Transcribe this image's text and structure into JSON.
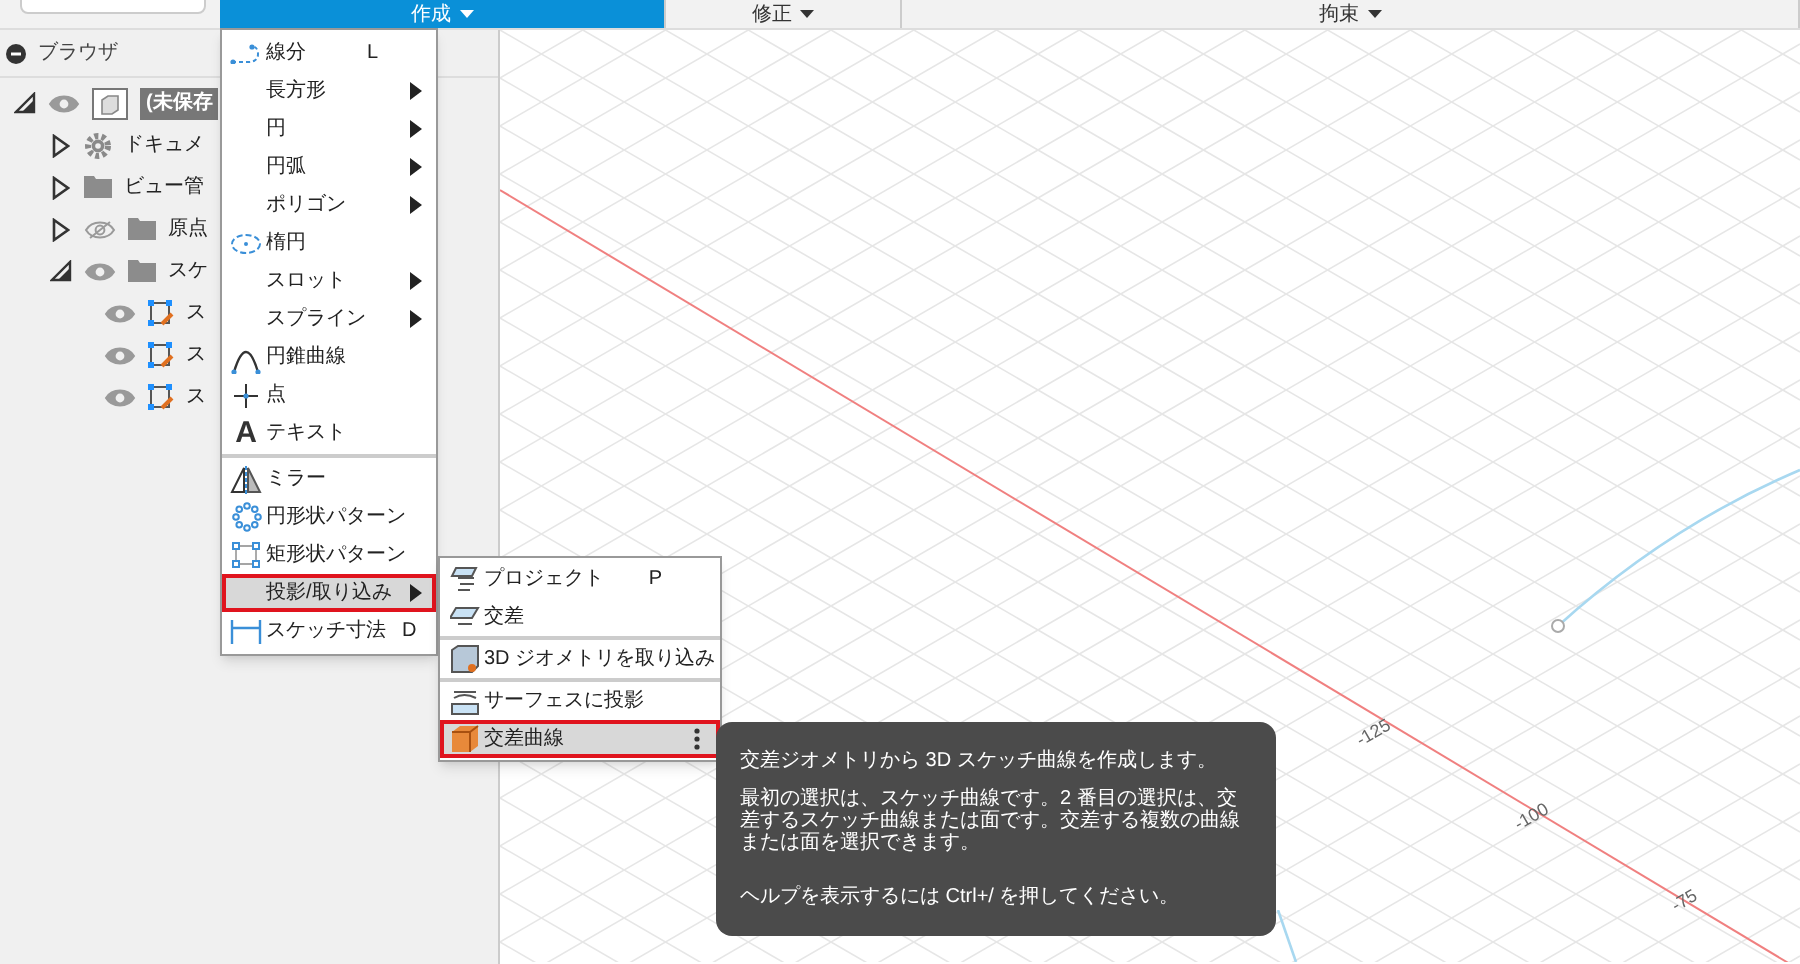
{
  "toolbar": {
    "tabs": [
      {
        "label": "作成",
        "selected": true
      },
      {
        "label": "修正",
        "selected": false
      },
      {
        "label": "拘束",
        "selected": false
      }
    ]
  },
  "browser": {
    "title": "ブラウザ",
    "tree": [
      {
        "label": "(未保存",
        "kind": "component",
        "expanded": true,
        "visible": true,
        "children": [
          {
            "label": "ドキュメ",
            "kind": "settings",
            "expanded": false
          },
          {
            "label": "ビュー管",
            "kind": "folder",
            "expanded": false
          },
          {
            "label": "原点",
            "kind": "folder",
            "expanded": false,
            "visible": false
          },
          {
            "label": "スケ",
            "kind": "folder",
            "expanded": true,
            "visible": true,
            "children": [
              {
                "label": "ス",
                "kind": "sketch",
                "visible": true
              },
              {
                "label": "ス",
                "kind": "sketch",
                "visible": true
              },
              {
                "label": "ス",
                "kind": "sketch",
                "visible": true
              }
            ]
          }
        ]
      }
    ]
  },
  "menu": {
    "groups": [
      [
        {
          "label": "線分",
          "shortcut": "L",
          "submenu": false,
          "selected": false
        },
        {
          "label": "長方形",
          "submenu": true,
          "selected": false
        },
        {
          "label": "円",
          "submenu": true,
          "selected": false
        },
        {
          "label": "円弧",
          "submenu": true,
          "selected": false
        },
        {
          "label": "ポリゴン",
          "submenu": true,
          "selected": false
        },
        {
          "label": "楕円",
          "submenu": false,
          "selected": false
        },
        {
          "label": "スロット",
          "submenu": true,
          "selected": false
        },
        {
          "label": "スプライン",
          "submenu": true,
          "selected": false
        },
        {
          "label": "円錐曲線",
          "submenu": false,
          "selected": false
        },
        {
          "label": "点",
          "submenu": false,
          "selected": false
        },
        {
          "label": "テキスト",
          "glyph": "A",
          "submenu": false,
          "selected": false
        }
      ],
      [
        {
          "label": "ミラー",
          "submenu": false,
          "selected": false
        },
        {
          "label": "円形状パターン",
          "submenu": false,
          "selected": false
        },
        {
          "label": "矩形状パターン",
          "submenu": false,
          "selected": false
        },
        {
          "label": "投影/取り込み",
          "submenu": true,
          "selected": true
        },
        {
          "label": "スケッチ寸法",
          "shortcut": "D",
          "submenu": false,
          "selected": false
        }
      ]
    ]
  },
  "submenu": {
    "groups": [
      [
        {
          "label": "プロジェクト",
          "shortcut": "P",
          "selected": false,
          "more": false
        },
        {
          "label": "交差",
          "selected": false,
          "more": false
        }
      ],
      [
        {
          "label": "3D ジオメトリを取り込み",
          "selected": false,
          "more": false
        }
      ],
      [
        {
          "label": "サーフェスに投影",
          "selected": false,
          "more": false
        },
        {
          "label": "交差曲線",
          "selected": true,
          "more": true
        }
      ]
    ]
  },
  "tooltip": {
    "paragraphs": [
      "交差ジオメトリから 3D スケッチ曲線を作成します。",
      "最初の選択は、スケッチ曲線です。2 番目の選択は、交差するスケッチ曲線または面です。交差する複数の曲線または面を選択できます。",
      "ヘルプを表示するには Ctrl+/ を押してください。"
    ]
  },
  "canvas": {
    "axis_labels": [
      "-125",
      "-100",
      "-75"
    ]
  }
}
